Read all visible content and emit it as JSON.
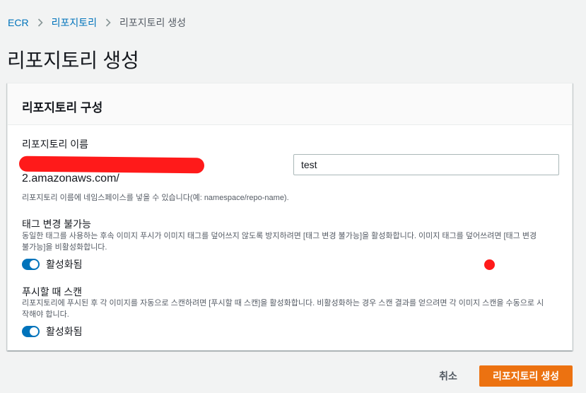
{
  "breadcrumb": {
    "items": [
      "ECR",
      "리포지토리",
      "리포지토리 생성"
    ]
  },
  "page_title": "리포지토리 생성",
  "panel": {
    "title": "리포지토리 구성",
    "repo_name": {
      "label": "리포지토리 이름",
      "uri_suffix": "2.amazonaws.com/",
      "value": "test",
      "hint": "리포지토리 이름에 네임스페이스를 넣을 수 있습니다(예: namespace/repo-name)."
    },
    "immutability": {
      "title": "태그 변경 불가능",
      "description_line1": "동일한 태그를 사용하는 후속 이미지 푸시가 이미지 태그를 덮어쓰지 않도록 방지하려면 [태그 변경 불가능]을 활성화합니다. 이미지 태그를 덮어쓰려면 [태그 변경",
      "description_line2": "불가능]을 비활성화합니다.",
      "toggle_label": "활성화됨"
    },
    "scan_on_push": {
      "title": "푸시할 때 스캔",
      "description_line1": "리포지토리에 푸시된 후 각 이미지를 자동으로 스캔하려면 [푸시할 때 스캔]을 활성화합니다. 비활성화하는 경우 스캔 결과를 얻으려면 각 이미지 스캔을 수동으로 시",
      "description_line2": "작해야 합니다.",
      "toggle_label": "활성화됨"
    }
  },
  "actions": {
    "cancel_label": "취소",
    "create_label": "리포지토리 생성"
  },
  "colors": {
    "link": "#0073bb",
    "primary_button": "#ec7211",
    "toggle_on": "#0073bb",
    "redaction": "#ff1a1a"
  }
}
